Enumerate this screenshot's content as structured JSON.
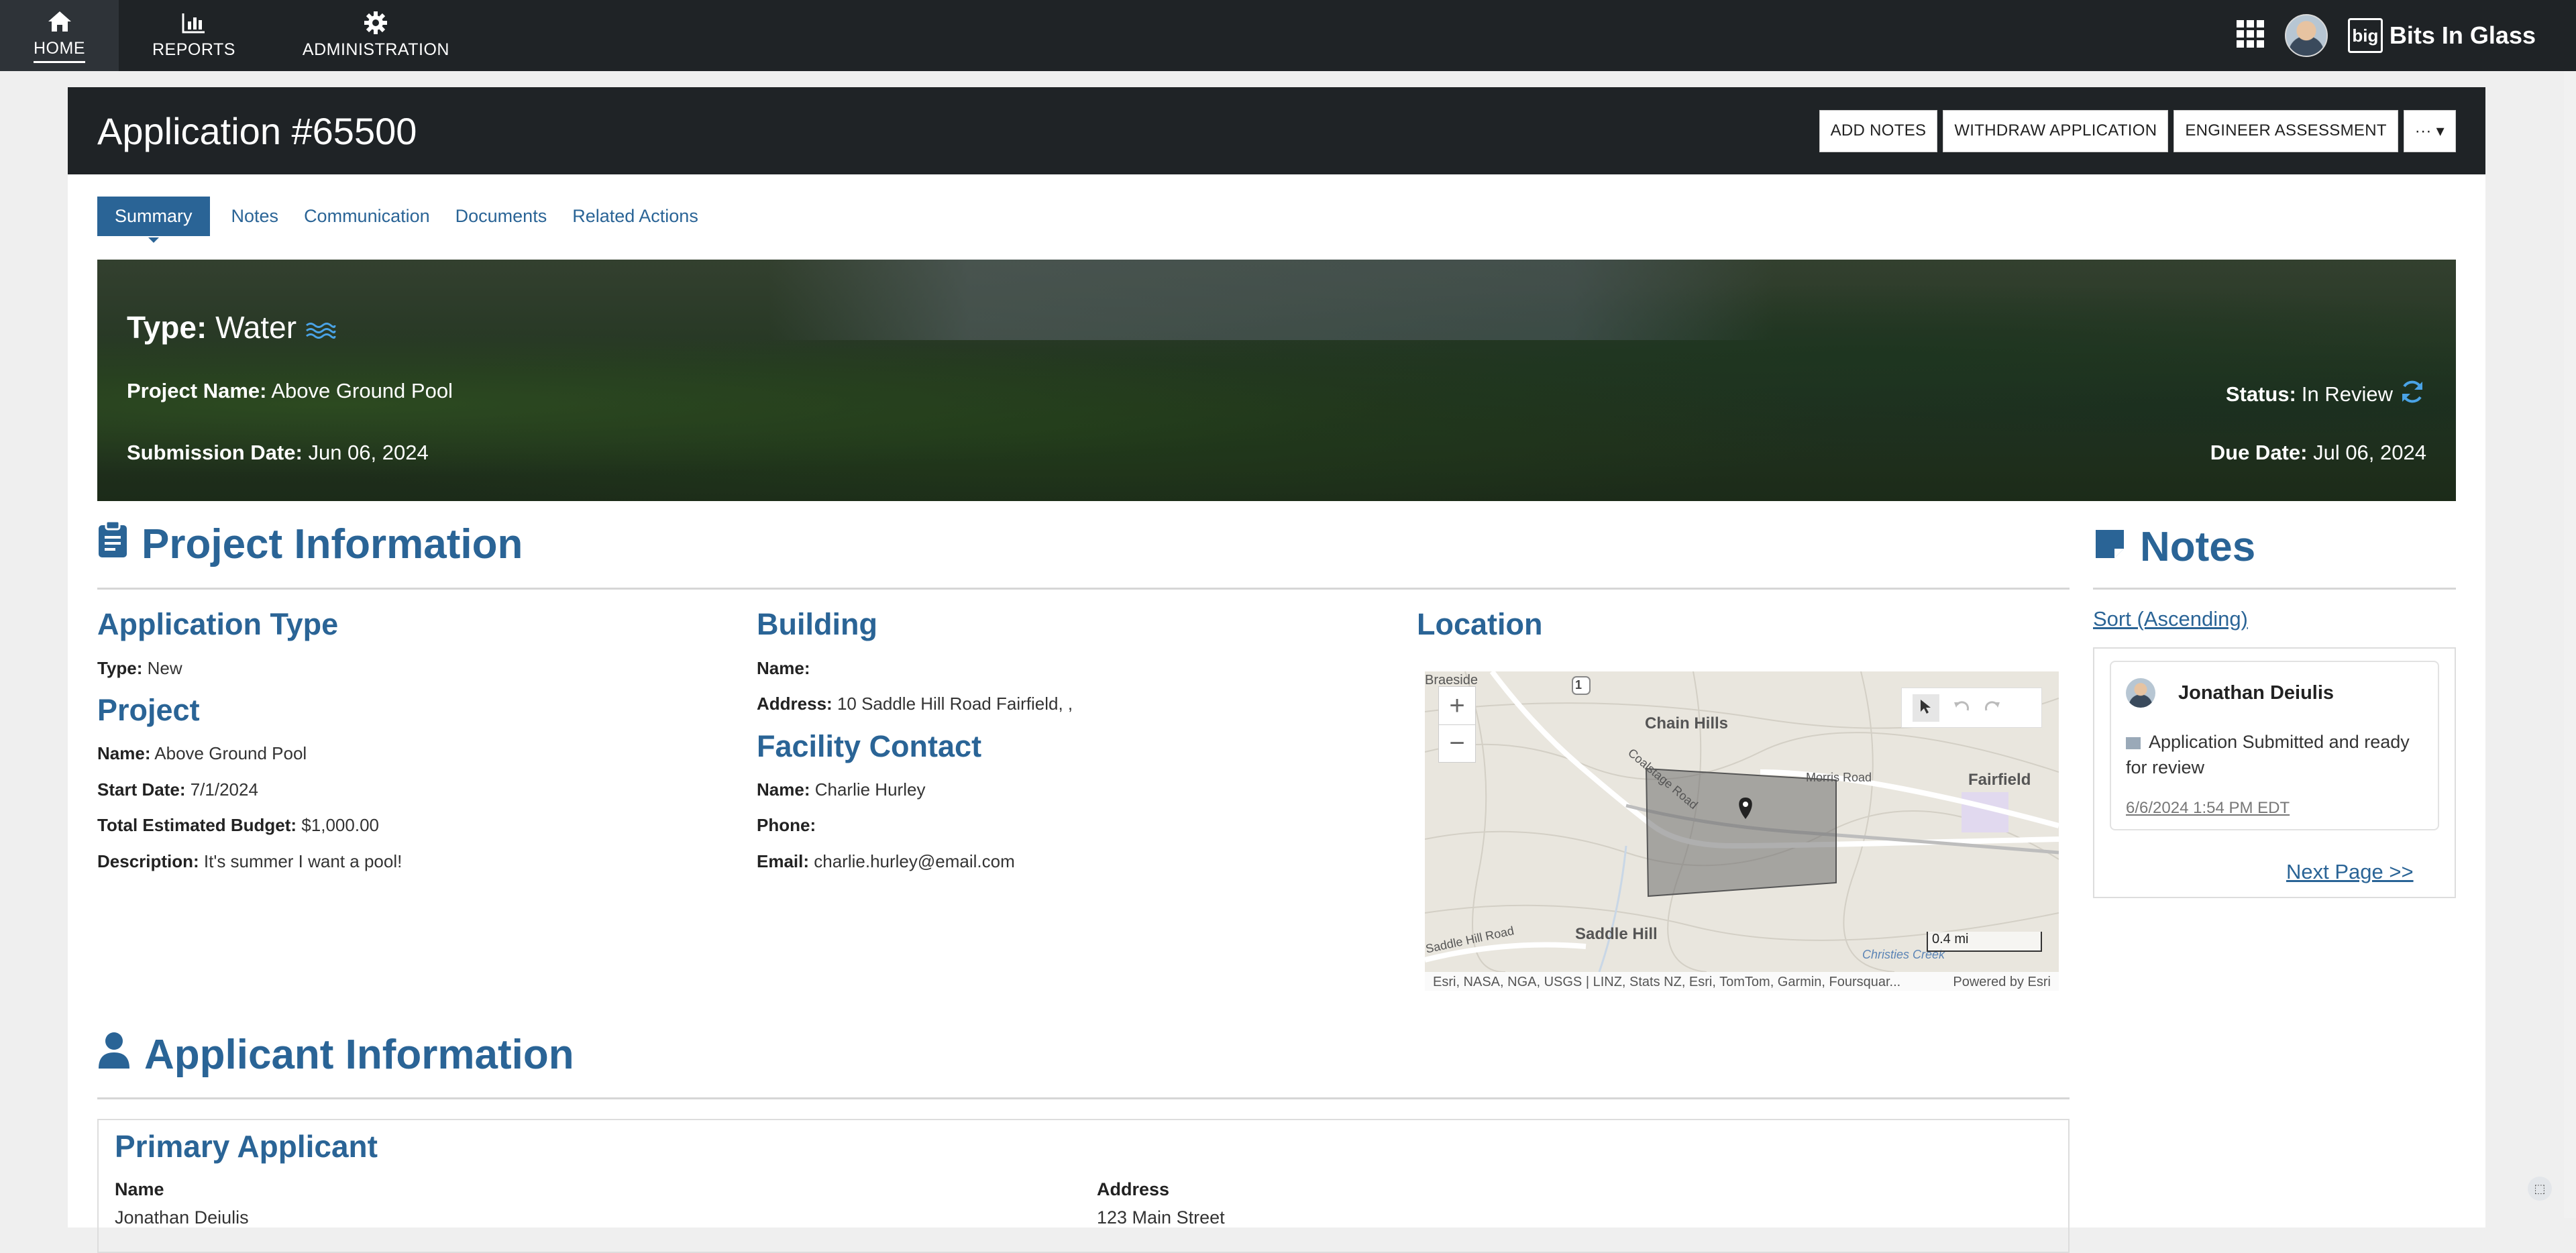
{
  "topnav": {
    "items": [
      {
        "label": "HOME",
        "icon": "home-icon",
        "active": true
      },
      {
        "label": "REPORTS",
        "icon": "chart-icon",
        "active": false
      },
      {
        "label": "ADMINISTRATION",
        "icon": "gear-icon",
        "active": false
      }
    ],
    "brand": "Bits In Glass",
    "brand_logo": "big"
  },
  "header": {
    "title": "Application #65500",
    "actions": [
      "ADD NOTES",
      "WITHDRAW APPLICATION",
      "ENGINEER ASSESSMENT",
      "··· ▾"
    ]
  },
  "tabs": [
    "Summary",
    "Notes",
    "Communication",
    "Documents",
    "Related Actions"
  ],
  "hero": {
    "type_label": "Type:",
    "type_value": "Water",
    "project_name_label": "Project Name:",
    "project_name": "Above Ground Pool",
    "submission_label": "Submission Date:",
    "submission_date": "Jun 06, 2024",
    "status_label": "Status:",
    "status": "In Review",
    "due_label": "Due Date:",
    "due_date": "Jul 06, 2024"
  },
  "project_info": {
    "title": "Project Information",
    "application_type": {
      "title": "Application Type",
      "type_label": "Type:",
      "type_value": "New"
    },
    "project": {
      "title": "Project",
      "name_label": "Name:",
      "name": "Above Ground Pool",
      "start_label": "Start Date:",
      "start": "7/1/2024",
      "budget_label": "Total Estimated Budget:",
      "budget": "$1,000.00",
      "desc_label": "Description:",
      "desc": "It's summer I want a pool!"
    },
    "building": {
      "title": "Building",
      "name_label": "Name:",
      "name": "",
      "address_label": "Address:",
      "address": "10 Saddle Hill Road Fairfield, ,"
    },
    "facility_contact": {
      "title": "Facility Contact",
      "name_label": "Name:",
      "name": "Charlie Hurley",
      "phone_label": "Phone:",
      "phone": "",
      "email_label": "Email:",
      "email": "charlie.hurley@email.com"
    },
    "location": {
      "title": "Location",
      "labels": [
        "Braeside",
        "Chain Hills",
        "Fairfield",
        "Saddle Hill",
        "Christies Creek",
        "Coalstage Road",
        "Morris Road",
        "Saddle Hill Road"
      ],
      "route_badge": "1",
      "scale": "0.4 mi",
      "attribution": "Esri, NASA, NGA, USGS | LINZ, Stats NZ, Esri, TomTom, Garmin, Foursquar...",
      "powered_by": "Powered by Esri"
    }
  },
  "notes": {
    "title": "Notes",
    "sort_label": "Sort (Ascending)",
    "items": [
      {
        "author": "Jonathan Deiulis",
        "text": "Application Submitted and ready for review",
        "date": "6/6/2024 1:54 PM EDT"
      }
    ],
    "next_page": "Next Page >>"
  },
  "applicant": {
    "title": "Applicant Information",
    "primary_title": "Primary Applicant",
    "name_header": "Name",
    "name_value": "Jonathan Deiulis",
    "address_header": "Address",
    "address_value": "123 Main Street"
  },
  "colors": {
    "nav_bg": "#1f2326",
    "accent": "#2a6496",
    "page_bg": "#efefef"
  }
}
